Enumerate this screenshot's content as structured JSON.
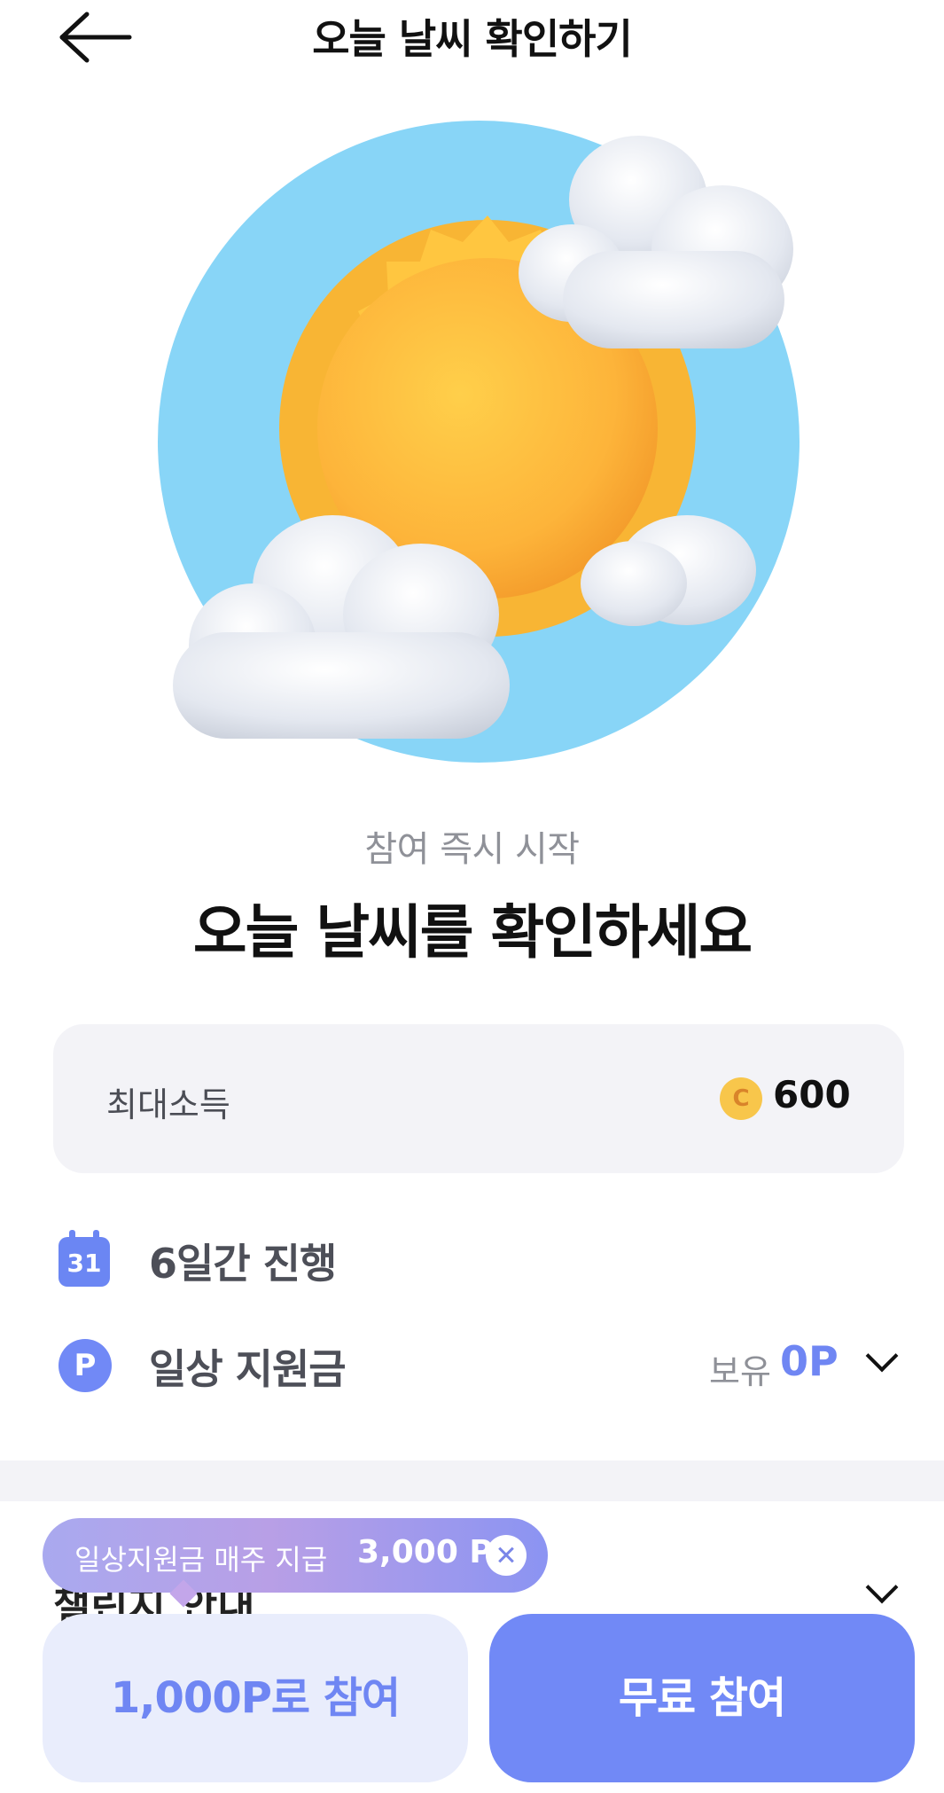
{
  "header": {
    "title": "오늘 날씨 확인하기",
    "back_icon": "arrow-left-icon"
  },
  "hero": {
    "illustration": "sun-and-clouds-icon",
    "circle_color": "#88d5f7"
  },
  "subtitle": "참여 즉시 시작",
  "main_title": "오늘 날씨를 확인하세요",
  "earn_card": {
    "label": "최대소득",
    "coin_icon_text": "C",
    "value": "600"
  },
  "info": {
    "duration_icon_text": "31",
    "duration_label": "6일간 진행",
    "support_icon_text": "P",
    "support_label": "일상 지원금",
    "own_label": "보유",
    "own_value": "0P"
  },
  "guide": {
    "title": "챌린지 안내"
  },
  "tooltip": {
    "text": "일상지원금 매주 지급",
    "amount": "3,000 P"
  },
  "buttons": {
    "points_label": "1,000P로 참여",
    "free_label": "무료 참여"
  },
  "colors": {
    "accent": "#7189f6",
    "accent_light": "#e9edfc",
    "card_bg": "#f3f3f7",
    "coin": "#f8c64b"
  }
}
